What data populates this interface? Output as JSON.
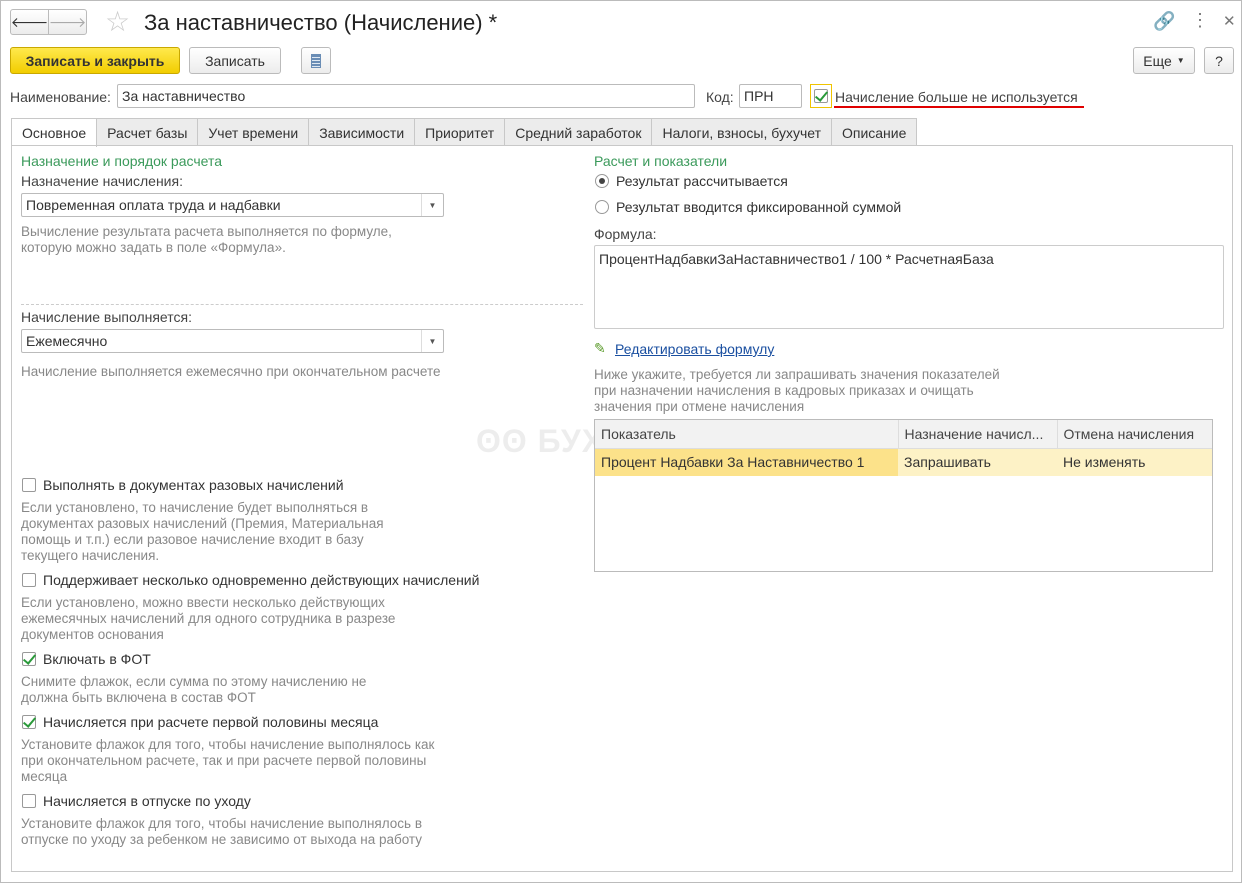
{
  "window": {
    "title": "За наставничество (Начисление) *"
  },
  "toolbar": {
    "save_close": "Записать и закрыть",
    "save": "Записать",
    "more": "Еще",
    "help": "?"
  },
  "fields": {
    "name_label": "Наименование:",
    "name_value": "За наставничество",
    "code_label": "Код:",
    "code_value": "ПРН",
    "not_used_label": "Начисление больше не используется"
  },
  "tabs": [
    "Основное",
    "Расчет базы",
    "Учет времени",
    "Зависимости",
    "Приоритет",
    "Средний заработок",
    "Налоги, взносы, бухучет",
    "Описание"
  ],
  "left": {
    "heading": "Назначение и порядок расчета",
    "purpose_label": "Назначение начисления:",
    "purpose_value": "Повременная оплата труда и надбавки",
    "purpose_desc": "Вычисление результата расчета выполняется по формуле, которую можно задать в поле «Формула».",
    "period_label": "Начисление выполняется:",
    "period_value": "Ежемесячно",
    "period_desc": "Начисление выполняется ежемесячно при окончательном расчете",
    "options": [
      {
        "label": "Выполнять в документах разовых начислений",
        "checked": false,
        "desc": "Если установлено, то начисление будет выполняться в документах разовых начислений (Премия, Материальная помощь и т.п.) если разовое начисление входит в базу текущего начисления."
      },
      {
        "label": "Поддерживает несколько одновременно действующих начислений",
        "checked": false,
        "desc": "Если установлено, можно ввести несколько действующих ежемесячных начислений для одного сотрудника в разрезе документов основания"
      },
      {
        "label": "Включать в ФОТ",
        "checked": true,
        "desc": "Снимите флажок, если сумма по этому начислению не должна быть включена в состав ФОТ"
      },
      {
        "label": "Начисляется при расчете первой половины месяца",
        "checked": true,
        "desc": "Установите флажок для того, чтобы начисление выполнялось как при окончательном расчете, так и при расчете первой половины месяца"
      },
      {
        "label": "Начисляется в отпуске по уходу",
        "checked": false,
        "desc": "Установите флажок для того, чтобы начисление выполнялось в отпуске по уходу за ребенком не зависимо от выхода на работу"
      }
    ]
  },
  "right": {
    "heading": "Расчет и показатели",
    "radio_calc": "Результат рассчитывается",
    "radio_fixed": "Результат вводится фиксированной суммой",
    "formula_label": "Формула:",
    "formula_value": "ПроцентНадбавкиЗаНаставничество1 / 100 * РасчетнаяБаза",
    "edit_formula": "Редактировать формулу",
    "hint": "Ниже укажите, требуется ли запрашивать значения показателей при назначении начисления в кадровых приказах и очищать значения при отмене начисления",
    "table": {
      "columns": [
        "Показатель",
        "Назначение начисл...",
        "Отмена начисления"
      ],
      "rows": [
        [
          "Процент Надбавки За Наставничество 1",
          "Запрашивать",
          "Не изменять"
        ]
      ]
    }
  },
  "watermark": "БУХЭКСПЕРТ"
}
